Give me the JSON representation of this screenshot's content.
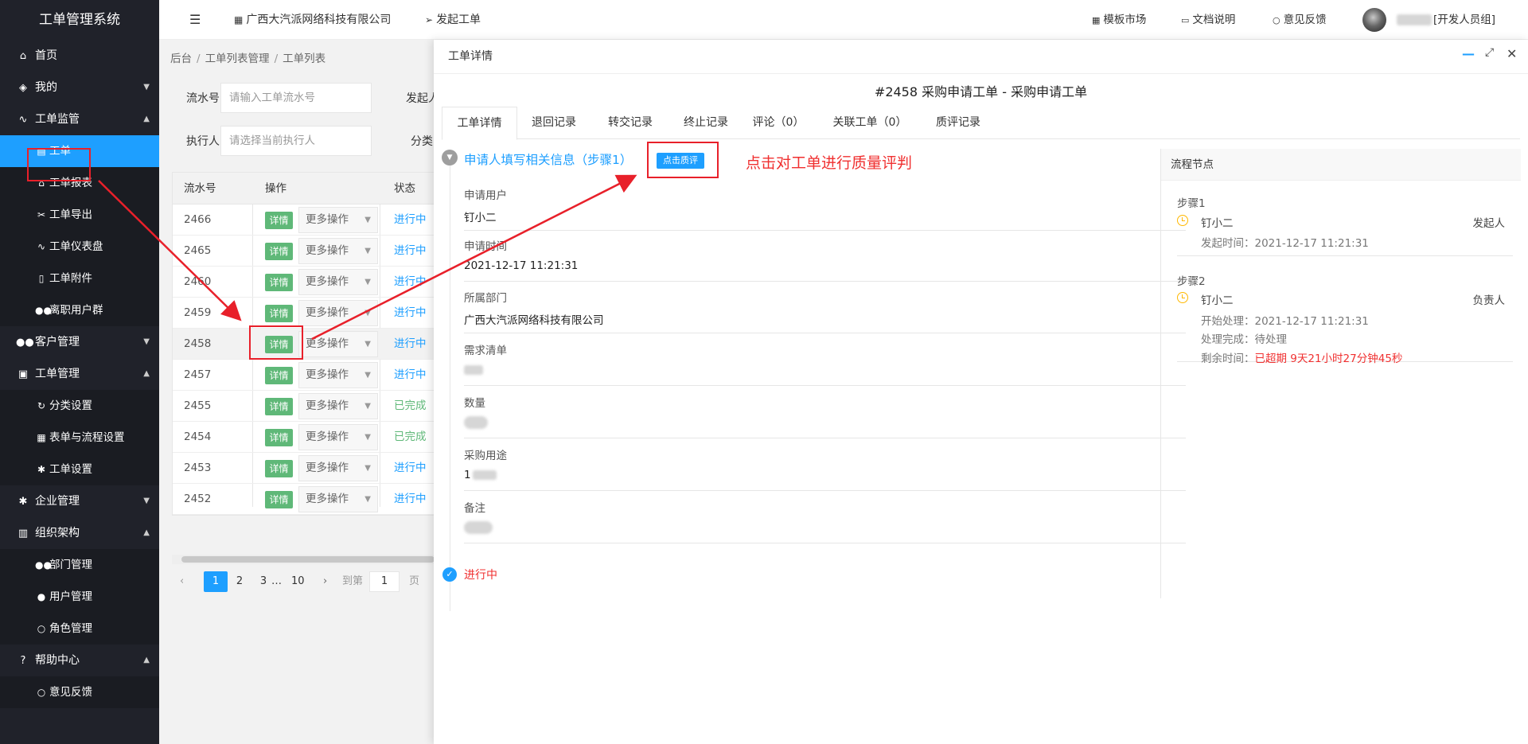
{
  "sidebar": {
    "brand": "工单管理系统",
    "items": [
      {
        "label": "首页",
        "icon": "home-icon"
      },
      {
        "label": "我的",
        "icon": "layers-icon"
      },
      {
        "label": "工单监管",
        "icon": "pulse-icon"
      },
      {
        "label": "客户管理",
        "icon": "users-icon"
      },
      {
        "label": "工单管理",
        "icon": "clipboard-icon"
      },
      {
        "label": "企业管理",
        "icon": "gear-icon"
      },
      {
        "label": "组织架构",
        "icon": "calendar-icon"
      },
      {
        "label": "帮助中心",
        "icon": "question-icon"
      }
    ],
    "monitor_sub": [
      {
        "label": "工单",
        "icon": "file-icon"
      },
      {
        "label": "工单报表",
        "icon": "home-icon"
      },
      {
        "label": "工单导出",
        "icon": "export-icon"
      },
      {
        "label": "工单仪表盘",
        "icon": "pulse-icon"
      },
      {
        "label": "工单附件",
        "icon": "file-icon"
      },
      {
        "label": "离职用户群",
        "icon": "users-icon"
      }
    ],
    "manage_sub": [
      {
        "label": "分类设置",
        "icon": "cycle-icon"
      },
      {
        "label": "表单与流程设置",
        "icon": "table-icon"
      },
      {
        "label": "工单设置",
        "icon": "gear-icon"
      }
    ],
    "org_sub": [
      {
        "label": "部门管理",
        "icon": "users-icon"
      },
      {
        "label": "用户管理",
        "icon": "user-icon"
      },
      {
        "label": "角色管理",
        "icon": "user-icon"
      }
    ],
    "help_sub": [
      {
        "label": "意见反馈",
        "icon": "circle-icon"
      }
    ]
  },
  "header": {
    "menu_icon": "menu-toggle-icon",
    "company": "广西大汽派网络科技有限公司",
    "start": "发起工单",
    "template": "模板市场",
    "docs": "文档说明",
    "feedback": "意见反馈",
    "user_role": "[开发人员组]"
  },
  "breadcrumb": [
    "后台",
    "工单列表管理",
    "工单列表"
  ],
  "filters": {
    "serial_label": "流水号",
    "serial_placeholder": "请输入工单流水号",
    "initiator_label": "发起人",
    "executor_label": "执行人",
    "executor_placeholder": "请选择当前执行人",
    "category_label": "分类"
  },
  "table": {
    "headers": [
      "流水号",
      "操作",
      "状态"
    ],
    "detail_label": "详情",
    "more_label": "更多操作",
    "rows": [
      {
        "id": "2466",
        "status": "进行中",
        "color": "#1e9fff"
      },
      {
        "id": "2465",
        "status": "进行中",
        "color": "#1e9fff"
      },
      {
        "id": "2460",
        "status": "进行中",
        "color": "#1e9fff"
      },
      {
        "id": "2459",
        "status": "进行中",
        "color": "#1e9fff"
      },
      {
        "id": "2458",
        "status": "进行中",
        "color": "#1e9fff"
      },
      {
        "id": "2457",
        "status": "进行中",
        "color": "#1e9fff"
      },
      {
        "id": "2455",
        "status": "已完成",
        "color": "#5fb878"
      },
      {
        "id": "2454",
        "status": "已完成",
        "color": "#5fb878"
      },
      {
        "id": "2453",
        "status": "进行中",
        "color": "#1e9fff"
      },
      {
        "id": "2452",
        "status": "进行中",
        "color": "#1e9fff"
      }
    ]
  },
  "pager": {
    "prev": "‹",
    "pages": [
      "1",
      "2",
      "3"
    ],
    "ellipsis": "…",
    "last": "10",
    "next": "›",
    "goto": "到第",
    "current": "1",
    "page_unit": "页"
  },
  "drawer": {
    "title": "工单详情",
    "ticket_title": "#2458 采购申请工单 - 采购申请工单",
    "tabs": [
      "工单详情",
      "退回记录",
      "转交记录",
      "终止记录",
      "评论（0）",
      "关联工单（0）",
      "质评记录"
    ],
    "step_title": "申请人填写相关信息（步骤1）",
    "quality_button": "点击质评",
    "annotation": "点击对工单进行质量评判",
    "fields": [
      {
        "label": "申请用户",
        "value": "钉小二"
      },
      {
        "label": "申请时间",
        "value": "2021-12-17 11:21:31"
      },
      {
        "label": "所属部门",
        "value": "广西大汽派网络科技有限公司"
      },
      {
        "label": "需求清单",
        "value": ""
      },
      {
        "label": "数量",
        "value": ""
      },
      {
        "label": "采购用途",
        "value": "1"
      },
      {
        "label": "备注",
        "value": ""
      }
    ],
    "status": "进行中"
  },
  "flow": {
    "title": "流程节点",
    "step1": {
      "label": "步骤1",
      "name": "钉小二",
      "role": "发起人",
      "time_label": "发起时间：",
      "time": "2021-12-17 11:21:31"
    },
    "step2": {
      "label": "步骤2",
      "name": "钉小二",
      "role": "负责人",
      "start_label": "开始处理：",
      "start": "2021-12-17 11:21:31",
      "done_label": "处理完成：",
      "done": "待处理",
      "remain_label": "剩余时间：",
      "remain": "已超期 9天21小时27分钟45秒"
    }
  },
  "colors": {
    "accent": "#1e9fff",
    "success": "#5fb878",
    "danger": "#f03030",
    "sidebar_bg": "#20222a"
  }
}
